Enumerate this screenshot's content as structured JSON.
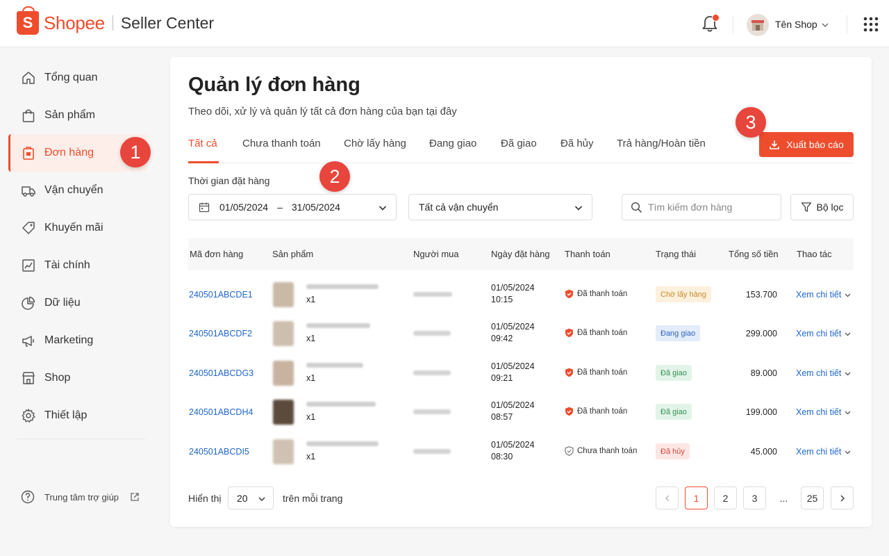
{
  "header": {
    "brand": "Shopee",
    "brand_sub": "Seller Center",
    "shop_name": "Tên Shop",
    "icons": [
      "bell-icon",
      "avatar",
      "chevron-down-icon",
      "apps-grid-icon"
    ]
  },
  "sidebar": {
    "items": [
      {
        "label": "Tổng quan",
        "icon": "home-icon"
      },
      {
        "label": "Sản phẩm",
        "icon": "bag-icon"
      },
      {
        "label": "Đơn hàng",
        "icon": "order-icon",
        "active": true
      },
      {
        "label": "Vận chuyển",
        "icon": "truck-icon"
      },
      {
        "label": "Khuyến mãi",
        "icon": "tag-icon"
      },
      {
        "label": "Tài chính",
        "icon": "chart-icon"
      },
      {
        "label": "Dữ liệu",
        "icon": "pie-icon"
      },
      {
        "label": "Marketing",
        "icon": "megaphone-icon"
      },
      {
        "label": "Shop",
        "icon": "store-icon"
      },
      {
        "label": "Thiết lập",
        "icon": "gear-icon"
      }
    ],
    "help_label": "Trung tâm trợ giúp"
  },
  "markers": [
    "1",
    "2",
    "3"
  ],
  "page": {
    "title": "Quản lý đơn hàng",
    "subtitle": "Theo dõi, xử lý và quản lý tất cả đơn hàng của bạn tại đây",
    "tabs": [
      "Tất cả",
      "Chưa thanh toán",
      "Chờ lấy hàng",
      "Đang giao",
      "Đã giao",
      "Đã hủy",
      "Trả hàng/Hoàn tiền"
    ],
    "active_tab": "Tất cả",
    "export_label": "Xuất báo cáo"
  },
  "filters": {
    "date_label": "Thời gian đặt hàng",
    "date_from": "01/05/2024",
    "date_sep": "–",
    "date_to": "31/05/2024",
    "shipping": "Tất cả vận chuyển",
    "search_placeholder": "Tìm kiếm đơn hàng",
    "filter_label": "Bộ lọc"
  },
  "table": {
    "columns": [
      "Mã đơn hàng",
      "Sản phẩm",
      "Người mua",
      "Ngày đặt hàng",
      "Thanh toán",
      "Trạng thái",
      "Tổng số tiền",
      "Thao tác"
    ],
    "rows": [
      {
        "id": "240501ABCDE1",
        "qty": "x1",
        "date": "01/05/2024",
        "time": "10:15",
        "payment": "Đã thanh toán",
        "paid": true,
        "status": "Chờ lấy hàng",
        "status_color": "#c98a2c",
        "status_bg": "#fdf0dc",
        "total": "153.700",
        "action": "Xem chi tiết"
      },
      {
        "id": "240501ABCDF2",
        "qty": "x1",
        "date": "01/05/2024",
        "time": "09:42",
        "payment": "Đã thanh toán",
        "paid": true,
        "status": "Đang giao",
        "status_color": "#2e63b8",
        "status_bg": "#e3ecfb",
        "total": "299.000",
        "action": "Xem chi tiết"
      },
      {
        "id": "240501ABCDG3",
        "qty": "x1",
        "date": "01/05/2024",
        "time": "09:21",
        "payment": "Đã thanh toán",
        "paid": true,
        "status": "Đã giao",
        "status_color": "#2f9152",
        "status_bg": "#e2f4e8",
        "total": "89.000",
        "action": "Xem chi tiết"
      },
      {
        "id": "240501ABCDH4",
        "qty": "x1",
        "date": "01/05/2024",
        "time": "08:57",
        "payment": "Đã thanh toán",
        "paid": true,
        "status": "Đã giao",
        "status_color": "#2f9152",
        "status_bg": "#e2f4e8",
        "total": "199.000",
        "action": "Xem chi tiết"
      },
      {
        "id": "240501ABCDI5",
        "qty": "x1",
        "date": "01/05/2024",
        "time": "08:30",
        "payment": "Chưa thanh toán",
        "paid": false,
        "status": "Đã hủy",
        "status_color": "#d9453a",
        "status_bg": "#fde6e4",
        "total": "45.000",
        "action": "Xem chi tiết"
      }
    ]
  },
  "pagination": {
    "show_label": "Hiển thị",
    "per_page": "20",
    "per_page_label": "trên mỗi trang",
    "pages": [
      "1",
      "2",
      "3",
      "...",
      "25"
    ],
    "current": "1"
  },
  "colors": {
    "brand": "#ee4d2d",
    "link": "#1f66c9",
    "marker": "#e8453c"
  }
}
